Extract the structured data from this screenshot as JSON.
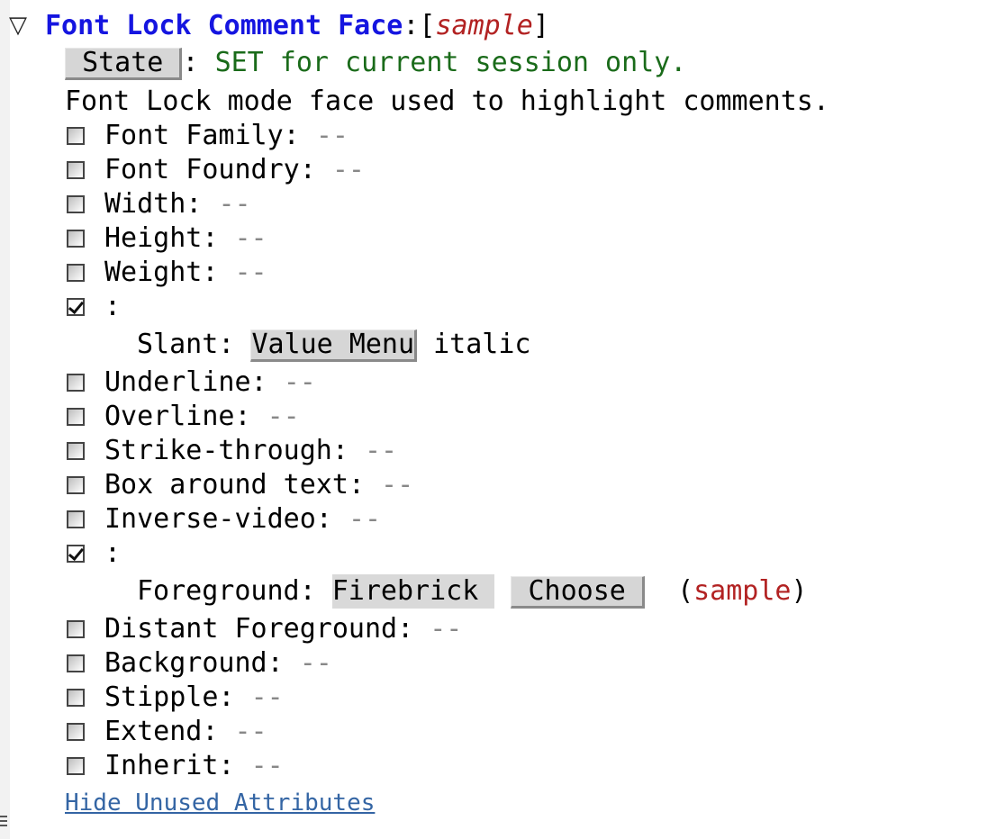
{
  "header": {
    "expand_icon": "triangle-down-icon",
    "face_name": "Font Lock Comment Face",
    "separator": ":",
    "bracket_open": "[",
    "sample": "sample",
    "bracket_close": "]"
  },
  "state": {
    "button_label": "State",
    "colon": ":",
    "text": "SET for current session only."
  },
  "doc": "Font Lock mode face used to highlight comments.",
  "attributes": [
    {
      "label": "Font Family:",
      "value": "--",
      "checked": false
    },
    {
      "label": "Font Foundry:",
      "value": "--",
      "checked": false
    },
    {
      "label": "Width:",
      "value": "--",
      "checked": false
    },
    {
      "label": "Height:",
      "value": "--",
      "checked": false
    },
    {
      "label": "Weight:",
      "value": "--",
      "checked": false
    },
    {
      "label": ":",
      "checked": true
    },
    {
      "label": "Underline:",
      "value": "--",
      "checked": false
    },
    {
      "label": "Overline:",
      "value": "--",
      "checked": false
    },
    {
      "label": "Strike-through:",
      "value": "--",
      "checked": false
    },
    {
      "label": "Box around text:",
      "value": "--",
      "checked": false
    },
    {
      "label": "Inverse-video:",
      "value": "--",
      "checked": false
    },
    {
      "label": ":",
      "checked": true
    },
    {
      "label": "Distant Foreground:",
      "value": "--",
      "checked": false
    },
    {
      "label": "Background:",
      "value": "--",
      "checked": false
    },
    {
      "label": "Stipple:",
      "value": "--",
      "checked": false
    },
    {
      "label": "Extend:",
      "value": "--",
      "checked": false
    },
    {
      "label": "Inherit:",
      "value": "--",
      "checked": false
    }
  ],
  "slant": {
    "label": "Slant:",
    "menu_button": "Value Menu",
    "value": "italic"
  },
  "foreground": {
    "label": "Foreground:",
    "value": "Firebrick",
    "choose_button": "Choose",
    "paren_open": "(",
    "sample": "sample",
    "paren_close": ")"
  },
  "footer": {
    "link": "Hide Unused Attributes"
  },
  "colors": {
    "face_name": "#1515e0",
    "sample": "#b22222",
    "state_text": "#1a6b1a",
    "link": "#3465a4"
  }
}
